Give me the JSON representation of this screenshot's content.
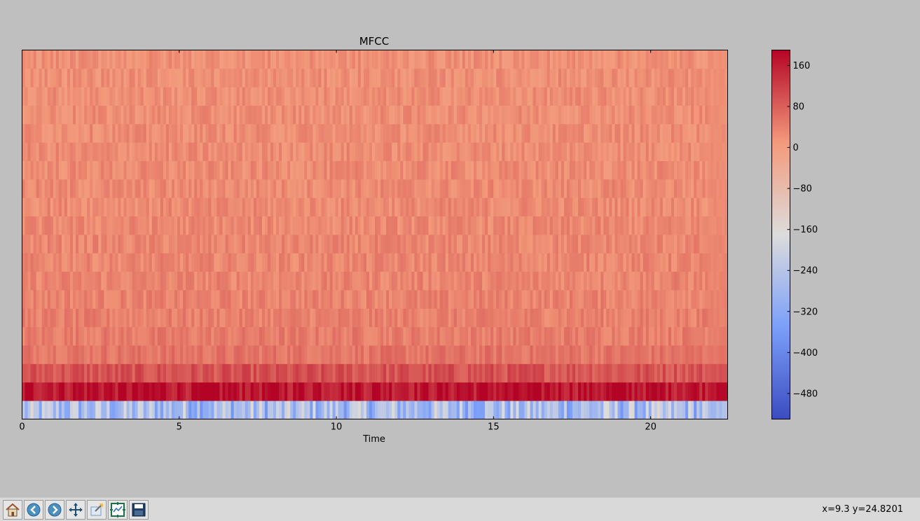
{
  "toolbar": {
    "buttons": [
      {
        "name": "home",
        "icon": "home-icon"
      },
      {
        "name": "back",
        "icon": "back-arrow-icon"
      },
      {
        "name": "forward",
        "icon": "forward-arrow-icon"
      },
      {
        "name": "pan",
        "icon": "pan-move-icon"
      },
      {
        "name": "zoom",
        "icon": "zoom-rect-icon"
      },
      {
        "name": "subplots",
        "icon": "configure-subplots-icon"
      },
      {
        "name": "save",
        "icon": "floppy-disk-icon"
      }
    ],
    "coord_readout": "x=9.3 y=24.8201"
  },
  "chart_data": {
    "type": "heatmap",
    "title": "MFCC",
    "xlabel": "Time",
    "ylabel": "",
    "xlim": [
      0,
      22.45
    ],
    "xticks": [
      0,
      5,
      10,
      15,
      20
    ],
    "xtick_labels": [
      "0",
      "5",
      "10",
      "15",
      "20"
    ],
    "n_coefficients": 20,
    "colormap": "coolwarm",
    "colorbar": {
      "vmin": -530,
      "vmax": 190,
      "ticks": [
        160,
        80,
        0,
        -80,
        -160,
        -240,
        -320,
        -400,
        -480
      ],
      "tick_labels": [
        "160",
        "80",
        "0",
        "−80",
        "−160",
        "−240",
        "−320",
        "−400",
        "−480"
      ],
      "placement": "right"
    },
    "approx_row_levels": [
      -265,
      175,
      95,
      55,
      45,
      40,
      38,
      35,
      33,
      32,
      30,
      29,
      28,
      27,
      26,
      25,
      24,
      23,
      22,
      21
    ]
  }
}
